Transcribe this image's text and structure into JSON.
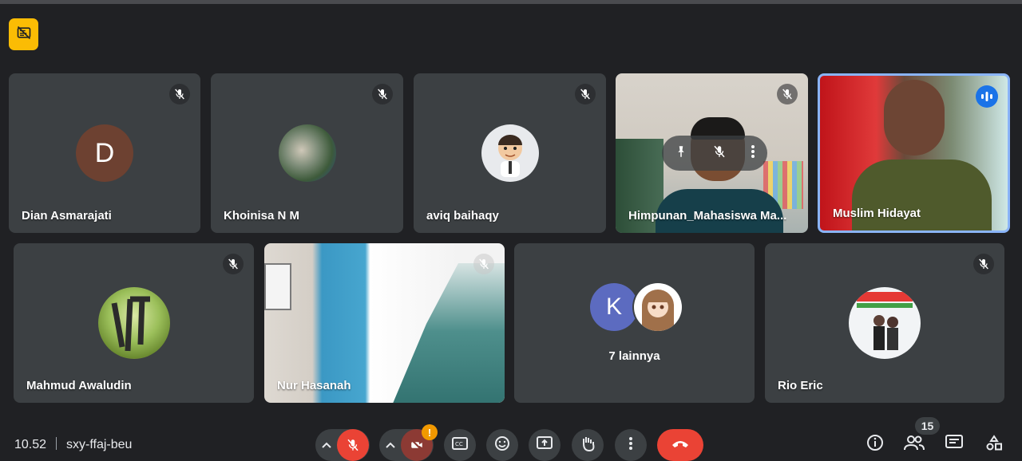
{
  "meeting": {
    "time": "10.52",
    "code": "sxy-ffaj-beu"
  },
  "participants_count": "15",
  "row1": [
    {
      "name": "Dian Asmarajati",
      "avatar_letter": "D",
      "avatar_color": "#6d4131"
    },
    {
      "name": "Khoinisa N M"
    },
    {
      "name": "aviq baihaqy"
    },
    {
      "name": "Himpunan_Mahasiswa Ma..."
    },
    {
      "name": "Muslim Hidayat"
    }
  ],
  "row2": [
    {
      "name": "Mahmud Awaludin"
    },
    {
      "name": "Nur Hasanah"
    },
    {
      "name": "7 lainnya",
      "avatar_letter": "K",
      "avatar_color": "#5c6bc0"
    },
    {
      "name": "Rio Eric"
    }
  ],
  "colors": {
    "background": "#202124",
    "tile": "#3c4043",
    "leave": "#ea4335",
    "warning_badge": "#fbbc04",
    "speaking": "#1a73e8",
    "mic_off": "#ea4335"
  },
  "icons": [
    "no-video-badge-icon",
    "mic-off-icon",
    "pin-icon",
    "more-vert-icon",
    "speaking-icon",
    "chevron-up-icon",
    "camera-off-icon",
    "captions-icon",
    "emoji-icon",
    "present-icon",
    "raise-hand-icon",
    "call-end-icon",
    "info-icon",
    "people-icon",
    "chat-icon",
    "activities-icon"
  ],
  "alerts": {
    "camera_warning": "!"
  }
}
